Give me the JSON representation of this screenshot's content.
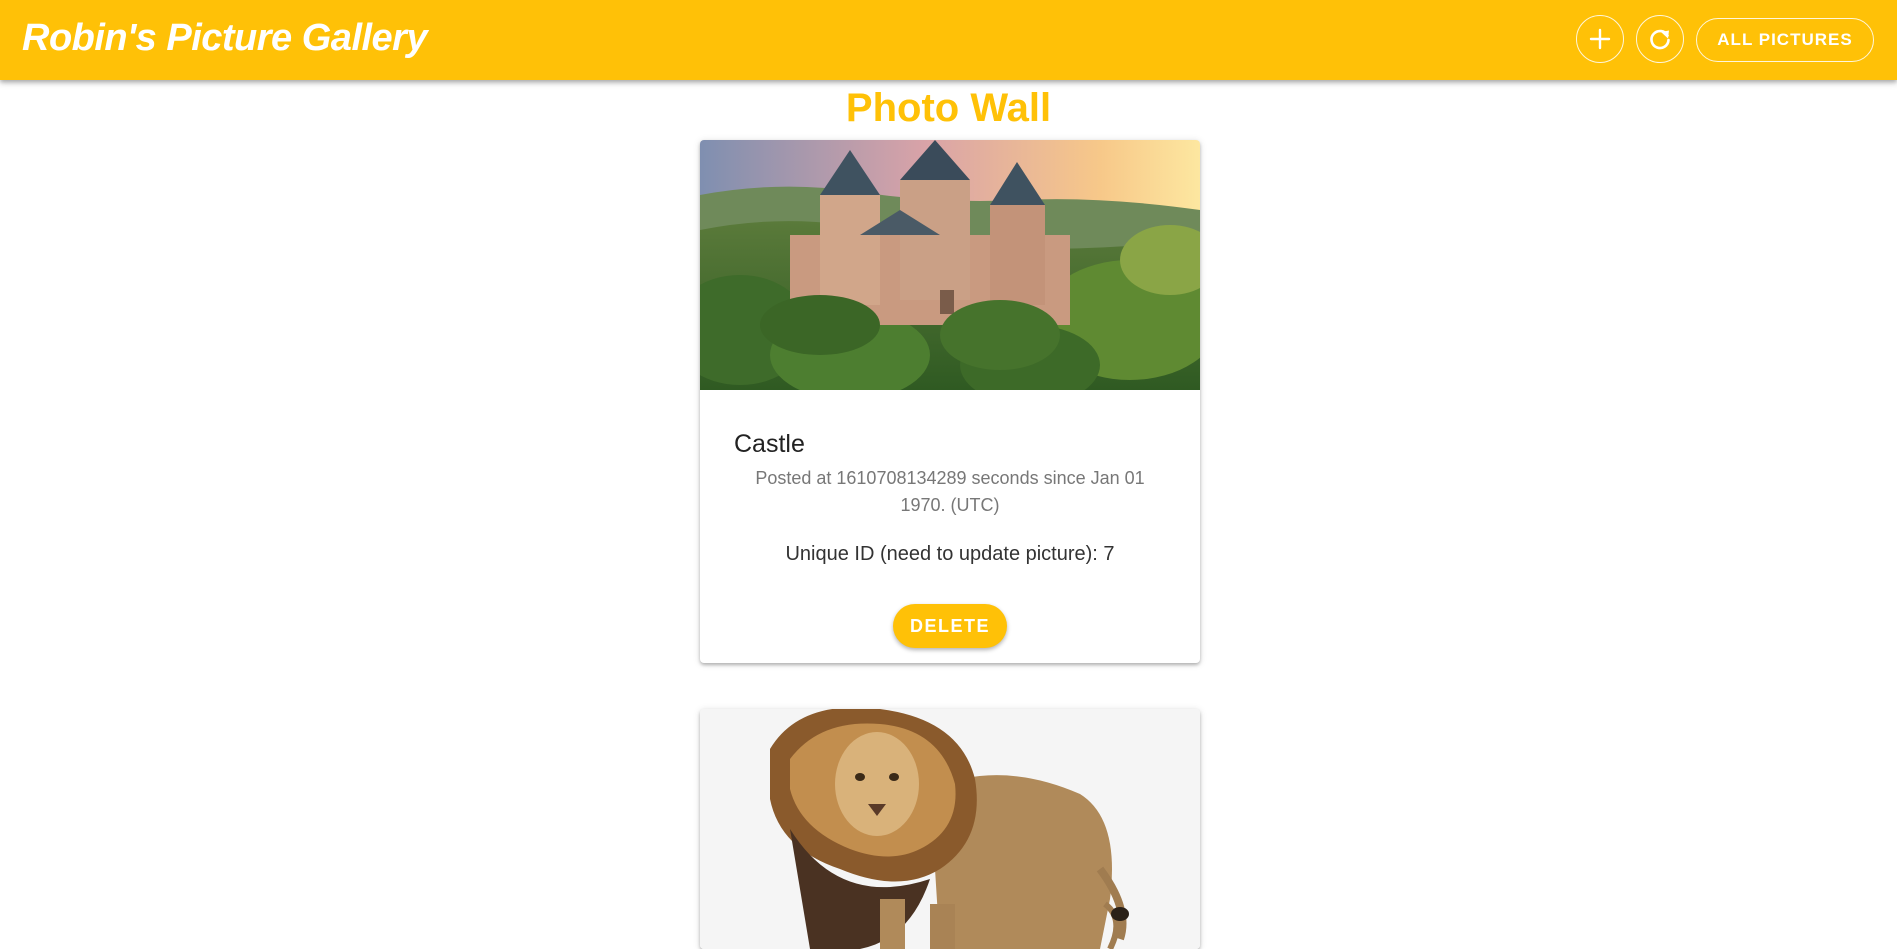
{
  "header": {
    "title": "Robin's Picture Gallery",
    "add_icon": "plus-icon",
    "refresh_icon": "refresh-icon",
    "all_pictures_label": "ALL PICTURES"
  },
  "page": {
    "heading": "Photo Wall"
  },
  "posts": [
    {
      "title": "Castle",
      "posted": "Posted at 1610708134289 seconds since Jan 01 1970. (UTC)",
      "unique_id": "Unique ID (need to update picture): 7",
      "delete_label": "DELETE"
    },
    {
      "title": "",
      "posted": "",
      "unique_id": "",
      "delete_label": ""
    }
  ],
  "colors": {
    "accent": "#ffc107",
    "text_on_accent": "#ffffff"
  }
}
